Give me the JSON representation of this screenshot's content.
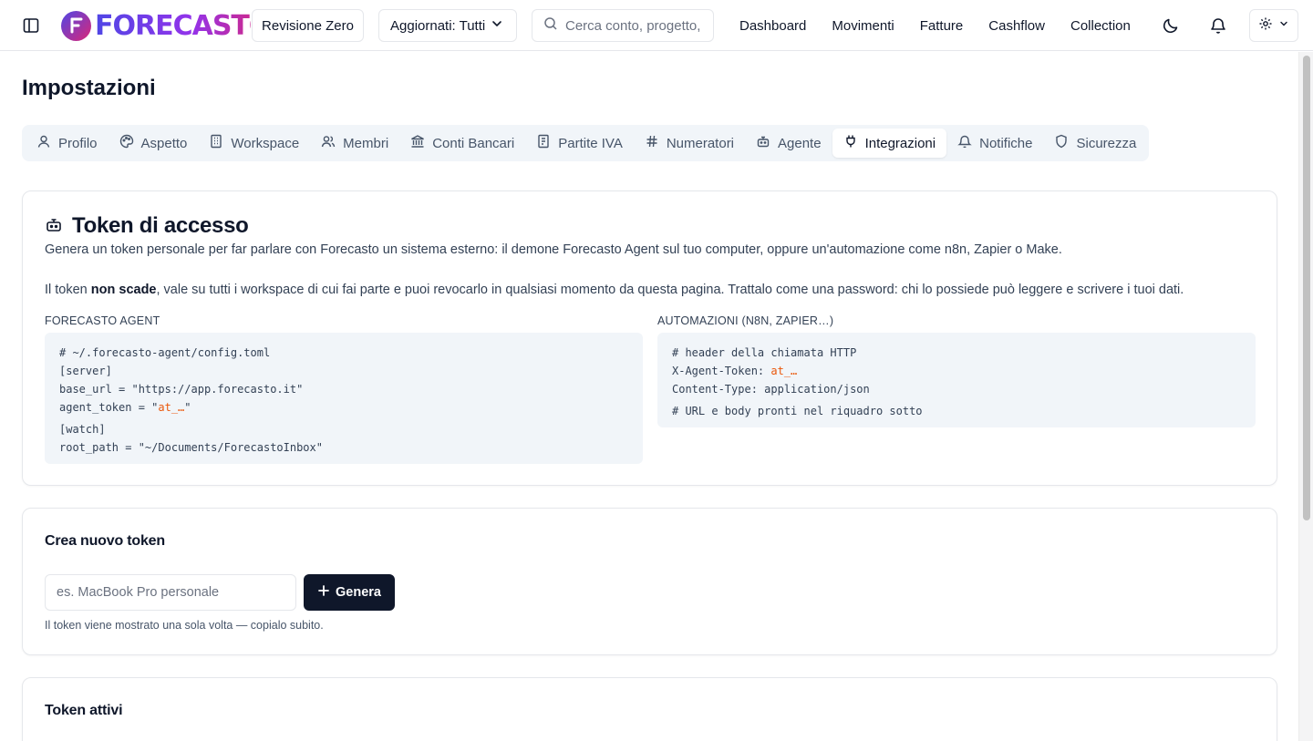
{
  "header": {
    "logo_text": "FORECASTO",
    "revision_label": "Revisione Zero",
    "filter_label": "Aggiornati: Tutti",
    "search_placeholder": "Cerca conto, progetto, ...",
    "nav": [
      "Dashboard",
      "Movimenti",
      "Fatture",
      "Cashflow",
      "Collection"
    ]
  },
  "page": {
    "title": "Impostazioni"
  },
  "tabs": [
    {
      "label": "Profilo",
      "icon": "user-icon"
    },
    {
      "label": "Aspetto",
      "icon": "palette-icon"
    },
    {
      "label": "Workspace",
      "icon": "building-icon"
    },
    {
      "label": "Membri",
      "icon": "users-icon"
    },
    {
      "label": "Conti Bancari",
      "icon": "bank-icon"
    },
    {
      "label": "Partite IVA",
      "icon": "receipt-icon"
    },
    {
      "label": "Numeratori",
      "icon": "hash-icon"
    },
    {
      "label": "Agente",
      "icon": "bot-icon"
    },
    {
      "label": "Integrazioni",
      "icon": "plug-icon",
      "active": true
    },
    {
      "label": "Notifiche",
      "icon": "bell-icon"
    },
    {
      "label": "Sicurezza",
      "icon": "shield-icon"
    }
  ],
  "token_access": {
    "title": "Token di accesso",
    "desc1": "Genera un token personale per far parlare con Forecasto un sistema esterno: il demone Forecasto Agent sul tuo computer, oppure un'automazione come n8n, Zapier o Make.",
    "desc2_pre": "Il token ",
    "desc2_bold": "non scade",
    "desc2_post": ", vale su tutti i workspace di cui fai parte e puoi revocarlo in qualsiasi momento da questa pagina. Trattalo come una password: chi lo possiede può leggere e scrivere i tuoi dati.",
    "agent_label": "FORECASTO AGENT",
    "agent_code": {
      "l1": "# ~/.forecasto-agent/config.toml",
      "l2": "[server]",
      "l3": "base_url = \"https://app.forecasto.it\"",
      "l4_pre": "agent_token = \"",
      "l4_tok": "at_…",
      "l4_post": "\"",
      "l5": "[watch]",
      "l6": "root_path = \"~/Documents/ForecastoInbox\""
    },
    "auto_label": "AUTOMAZIONI (N8N, ZAPIER…)",
    "auto_code": {
      "l1": "# header della chiamata HTTP",
      "l2_pre": "X-Agent-Token: ",
      "l2_tok": "at_…",
      "l3": "Content-Type: application/json",
      "l4": "# URL e body pronti nel riquadro sotto"
    }
  },
  "create_token": {
    "title": "Crea nuovo token",
    "input_placeholder": "es. MacBook Pro personale",
    "button_label": "Genera",
    "hint": "Il token viene mostrato una sola volta — copialo subito."
  },
  "active_tokens": {
    "title": "Token attivi"
  },
  "colors": {
    "accent_token": "#ea580c",
    "primary_button": "#0f172a",
    "tab_bar": "#f1f5f9"
  }
}
